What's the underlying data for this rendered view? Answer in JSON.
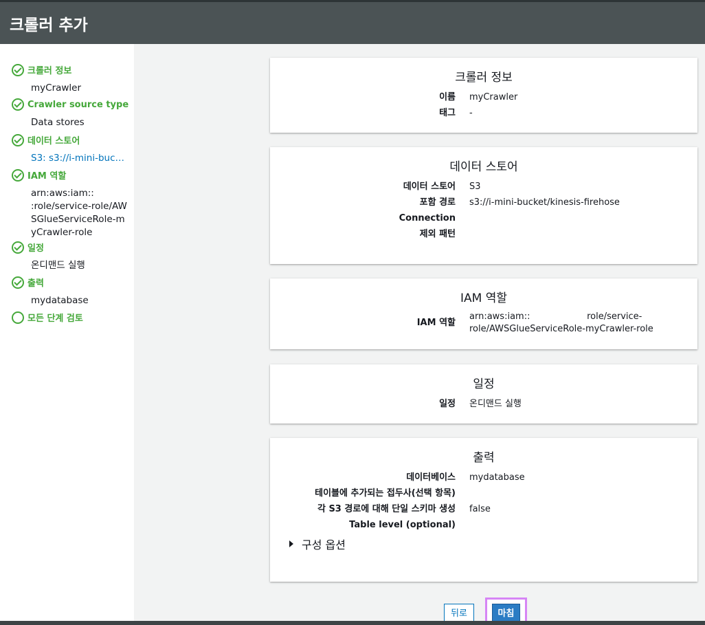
{
  "header": {
    "title": "크롤러 추가"
  },
  "sidebar": {
    "steps": [
      {
        "label": "크롤러 정보",
        "sub": "myCrawler",
        "status": "done"
      },
      {
        "label": "Crawler source type",
        "sub": "Data stores",
        "status": "done"
      },
      {
        "label": "데이터 스토어",
        "sub": "S3: s3://i-mini-bucket/kinesis-firehose",
        "status": "done"
      },
      {
        "label": "IAM 역할",
        "sub": "arn:aws:iam::\n          :role/service-role/AWSGlueServiceRole-myCrawler-role",
        "status": "done"
      },
      {
        "label": "일정",
        "sub": "온디맨드 실행",
        "status": "done"
      },
      {
        "label": "출력",
        "sub": "mydatabase",
        "status": "done"
      },
      {
        "label": "모든 단계 검토",
        "sub": "",
        "status": "current"
      }
    ]
  },
  "cards": {
    "crawler_info": {
      "title": "크롤러 정보",
      "rows": [
        {
          "key": "이름",
          "value": "myCrawler"
        },
        {
          "key": "태그",
          "value": "-"
        }
      ]
    },
    "data_store": {
      "title": "데이터 스토어",
      "rows": [
        {
          "key": "데이터 스토어",
          "value": "S3"
        },
        {
          "key": "포함 경로",
          "value": "s3://i-mini-bucket/kinesis-firehose"
        },
        {
          "key": "Connection",
          "value": ""
        },
        {
          "key": "제외 패턴",
          "value": ""
        }
      ]
    },
    "iam_role": {
      "title": "IAM 역할",
      "rows": [
        {
          "key": "IAM 역할",
          "value_line1": "arn:aws:iam::                    role/service-",
          "value_line2": "role/AWSGlueServiceRole-myCrawler-role"
        }
      ]
    },
    "schedule": {
      "title": "일정",
      "rows": [
        {
          "key": "일정",
          "value": "온디맨드 실행"
        }
      ]
    },
    "output": {
      "title": "출력",
      "rows": [
        {
          "key": "데이터베이스",
          "value": "mydatabase"
        },
        {
          "key": "테이블에 추가되는 접두사(선택 항목)",
          "value": ""
        },
        {
          "key": "각 S3 경로에 대해 단일 스키마 생성",
          "value": "false"
        },
        {
          "key": "Table level (optional)",
          "value": ""
        }
      ],
      "expand_label": "구성 옵션"
    }
  },
  "footer": {
    "back_label": "뒤로",
    "finish_label": "마침"
  },
  "colors": {
    "header_bg": "#4b5355",
    "accent_green": "#45a83a",
    "link_blue": "#0073bb",
    "primary_button": "#2b7cc4",
    "highlight_border": "#d685f5"
  }
}
